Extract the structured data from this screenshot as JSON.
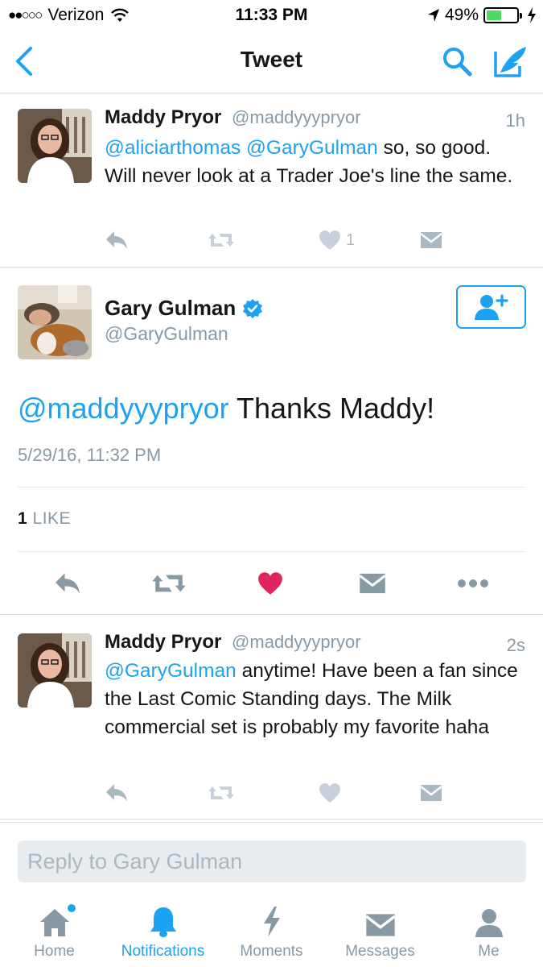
{
  "status_bar": {
    "carrier": "Verizon",
    "time": "11:33 PM",
    "battery": "49%",
    "battery_level": 0.49
  },
  "nav": {
    "title": "Tweet"
  },
  "tweets": [
    {
      "name": "Maddy Pryor",
      "handle": "@maddyyypryor",
      "time": "1h",
      "mention1": "@aliciarthomas",
      "mention2": "@GaryGulman",
      "text_a": "so, so good. Will never look at a Trader Joe's line the same.",
      "like_count": "1"
    },
    {
      "name": "Maddy Pryor",
      "handle": "@maddyyypryor",
      "time": "2s",
      "mention1": "@GaryGulman",
      "text_a": "anytime! Have been a fan since the Last Comic Standing days. The Milk commercial set is probably my favorite haha"
    }
  ],
  "focus": {
    "name": "Gary Gulman",
    "handle": "@GaryGulman",
    "mention": "@maddyyypryor",
    "text": "Thanks Maddy!",
    "date": "5/29/16, 11:32 PM",
    "like_count": "1",
    "like_label": "LIKE"
  },
  "reply": {
    "placeholder": "Reply to Gary Gulman"
  },
  "tabs": [
    {
      "label": "Home",
      "icon": "home-icon"
    },
    {
      "label": "Notifications",
      "icon": "bell-icon"
    },
    {
      "label": "Moments",
      "icon": "lightning-icon"
    },
    {
      "label": "Messages",
      "icon": "envelope-icon"
    },
    {
      "label": "Me",
      "icon": "person-icon"
    }
  ],
  "colors": {
    "accent": "#1da1f2",
    "muted": "#8899a6",
    "like": "#e0245e"
  }
}
